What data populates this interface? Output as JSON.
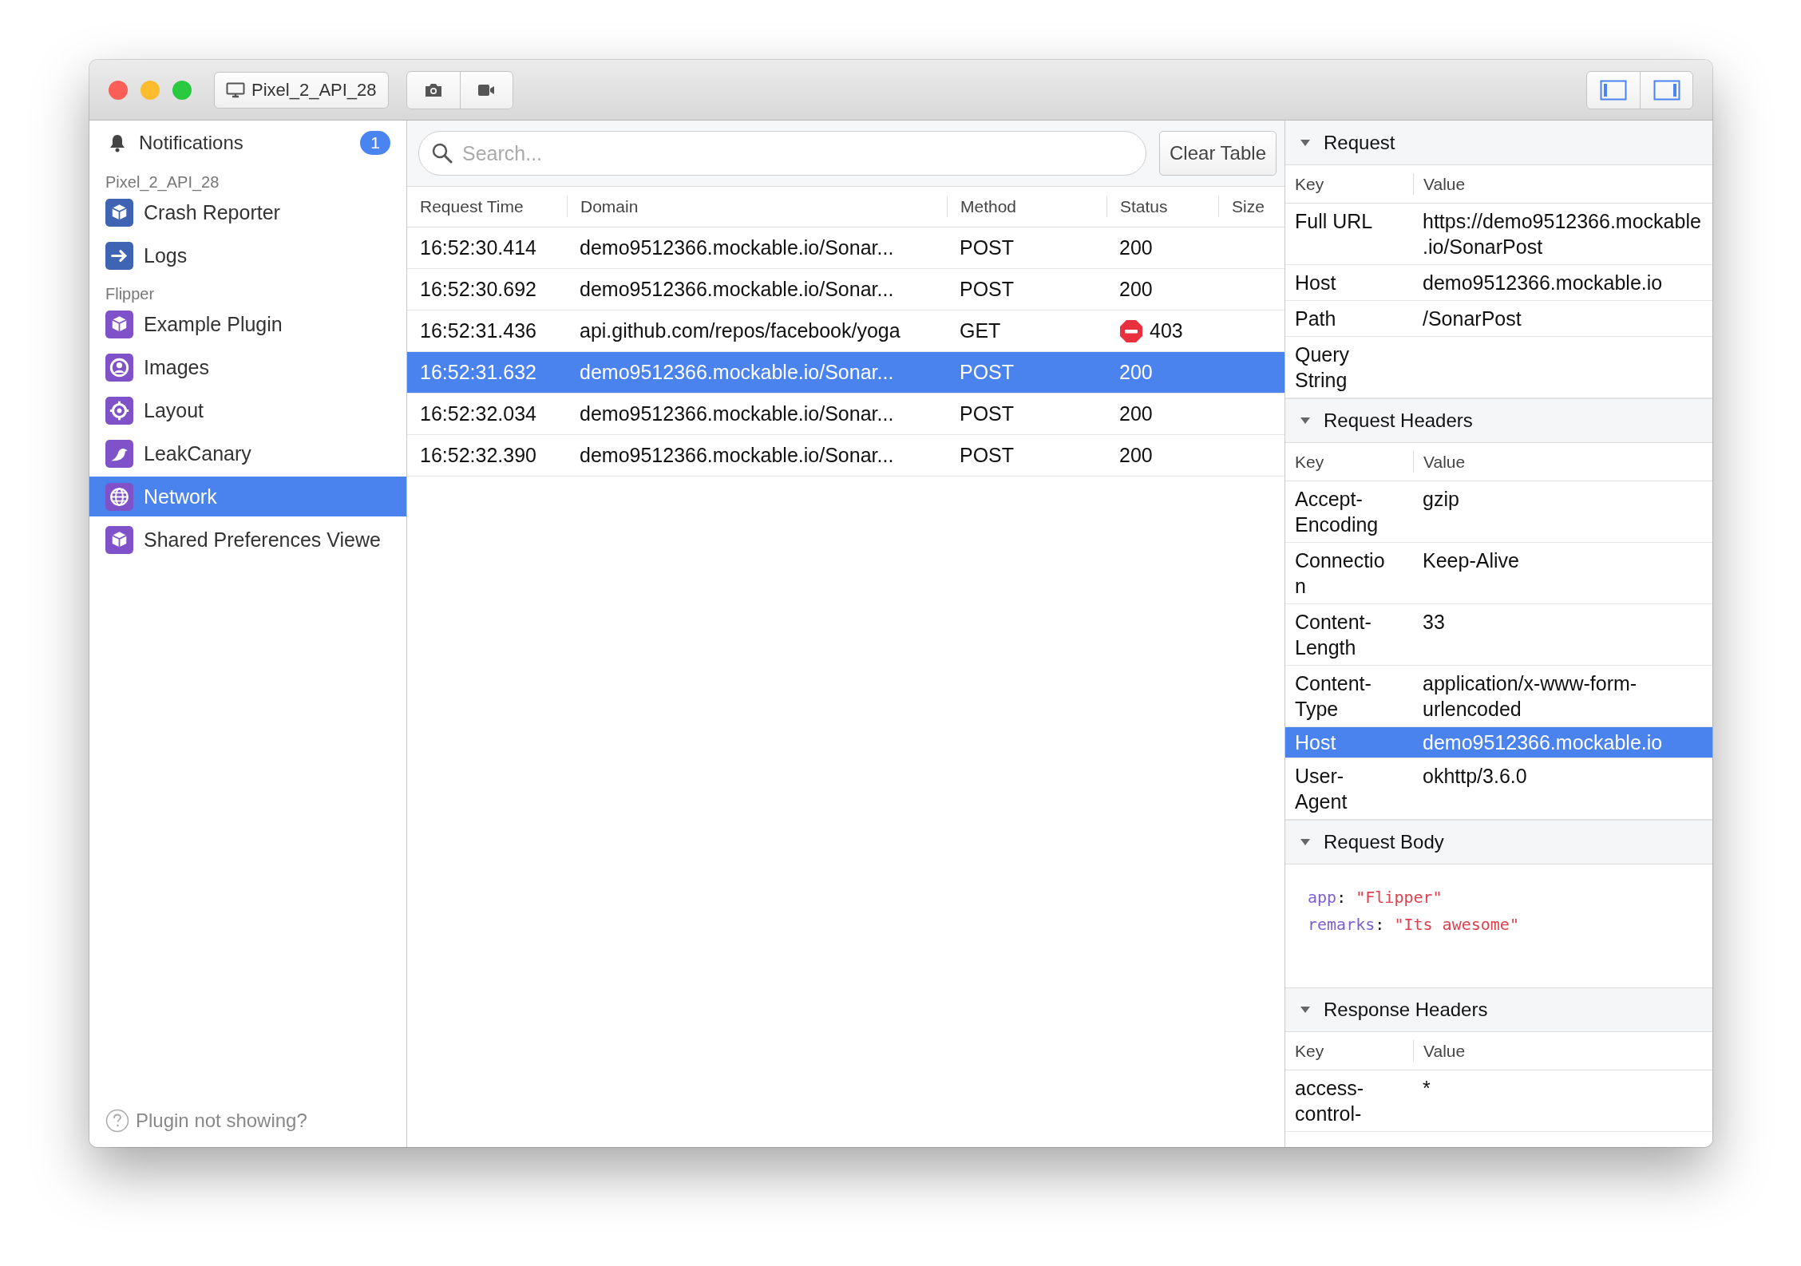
{
  "toolbar": {
    "device": "Pixel_2_API_28"
  },
  "sidebar": {
    "notifications": {
      "label": "Notifications",
      "badge": "1"
    },
    "groups": [
      {
        "title": "Pixel_2_API_28",
        "items": [
          {
            "label": "Crash Reporter",
            "color": "#3e64b3",
            "selected": false
          },
          {
            "label": "Logs",
            "color": "#3e64b3",
            "selected": false
          }
        ]
      },
      {
        "title": "Flipper",
        "items": [
          {
            "label": "Example Plugin",
            "color": "#8052c9",
            "selected": false
          },
          {
            "label": "Images",
            "color": "#8052c9",
            "selected": false
          },
          {
            "label": "Layout",
            "color": "#8052c9",
            "selected": false
          },
          {
            "label": "LeakCanary",
            "color": "#8052c9",
            "selected": false
          },
          {
            "label": "Network",
            "color": "#8052c9",
            "selected": true
          },
          {
            "label": "Shared Preferences Viewe",
            "color": "#8052c9",
            "selected": false
          }
        ]
      }
    ],
    "help": "Plugin not showing?"
  },
  "requests": {
    "search": {
      "placeholder": "Search..."
    },
    "clear_button": "Clear Table",
    "columns": [
      "Request Time",
      "Domain",
      "Method",
      "Status",
      "Size"
    ],
    "rows": [
      {
        "time": "16:52:30.414",
        "domain": "demo9512366.mockable.io/Sonar...",
        "method": "POST",
        "status": "200",
        "error": false,
        "selected": false
      },
      {
        "time": "16:52:30.692",
        "domain": "demo9512366.mockable.io/Sonar...",
        "method": "POST",
        "status": "200",
        "error": false,
        "selected": false
      },
      {
        "time": "16:52:31.436",
        "domain": "api.github.com/repos/facebook/yoga",
        "method": "GET",
        "status": "403",
        "error": true,
        "selected": false
      },
      {
        "time": "16:52:31.632",
        "domain": "demo9512366.mockable.io/Sonar...",
        "method": "POST",
        "status": "200",
        "error": false,
        "selected": true
      },
      {
        "time": "16:52:32.034",
        "domain": "demo9512366.mockable.io/Sonar...",
        "method": "POST",
        "status": "200",
        "error": false,
        "selected": false
      },
      {
        "time": "16:52:32.390",
        "domain": "demo9512366.mockable.io/Sonar...",
        "method": "POST",
        "status": "200",
        "error": false,
        "selected": false
      }
    ]
  },
  "details": {
    "sections": [
      {
        "title": "Request",
        "expanded": true,
        "kind": "table",
        "columns": [
          "Key",
          "Value"
        ],
        "rows": [
          {
            "key": "Full URL",
            "value": "https://demo9512366.mockable.io/SonarPost",
            "selected": false
          },
          {
            "key": "Host",
            "value": "demo9512366.mockable.io",
            "selected": false
          },
          {
            "key": "Path",
            "value": "/SonarPost",
            "selected": false
          },
          {
            "key": "Query String",
            "selected": false
          }
        ]
      },
      {
        "title": "Request Headers",
        "expanded": true,
        "kind": "table",
        "columns": [
          "Key",
          "Value"
        ],
        "rows": [
          {
            "key": "Accept-Encoding",
            "value": "gzip",
            "selected": false
          },
          {
            "key": "Connection",
            "value": "Keep-Alive",
            "selected": false
          },
          {
            "key": "Content-Length",
            "value": "33",
            "selected": false
          },
          {
            "key": "Content-Type",
            "value": "application/x-www-form-urlencoded",
            "selected": false
          },
          {
            "key": "Host",
            "value": "demo9512366.mockable.io",
            "selected": true
          },
          {
            "key": "User-Agent",
            "value": "okhttp/3.6.0",
            "selected": false
          }
        ]
      },
      {
        "title": "Request Body",
        "expanded": true,
        "kind": "body",
        "lines": [
          {
            "key": "app",
            "punct": ":",
            "value": "\"Flipper\""
          },
          {
            "key": "remarks",
            "punct": ":",
            "value": "\"Its awesome\""
          }
        ]
      },
      {
        "title": "Response Headers",
        "expanded": true,
        "kind": "table",
        "columns": [
          "Key",
          "Value"
        ],
        "rows": [
          {
            "key": "access-control-",
            "value": "*",
            "selected": false
          }
        ]
      }
    ]
  }
}
